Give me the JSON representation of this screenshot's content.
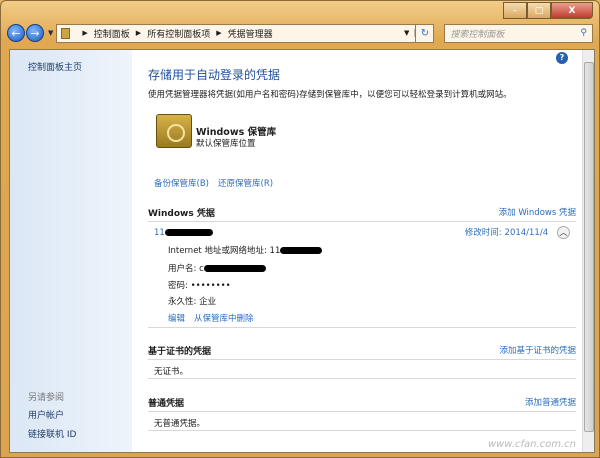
{
  "window": {
    "min": "–",
    "max": "□",
    "close": "X"
  },
  "nav": {
    "back": "←",
    "forward": "→",
    "breadcrumb": [
      "控制面板",
      "所有控制面板项",
      "凭据管理器"
    ],
    "refresh": "↻",
    "search_placeholder": "搜索控制面板",
    "search_icon": "search-icon"
  },
  "sidebar": {
    "home": "控制面板主页",
    "see_also": "另请参阅",
    "links": [
      "用户帐户",
      "链接联机 ID"
    ]
  },
  "main": {
    "title": "存储用于自动登录的凭据",
    "description": "使用凭据管理器将凭据(如用户名和密码)存储到保管库中，以便您可以轻松登录到计算机或网站。",
    "vault_name": "Windows 保管库",
    "vault_sub": "默认保管库位置",
    "backup": "备份保管库(B)",
    "restore": "还原保管库(R)",
    "windows_creds": {
      "header": "Windows 凭据",
      "add": "添加 Windows 凭据",
      "item": {
        "name_prefix": "11",
        "modified_label": "修改时间:",
        "modified": "2014/11/4",
        "address_label": "Internet 地址或网络地址:",
        "address_prefix": "11",
        "username_label": "用户名:",
        "username_prefix": "c",
        "password_label": "密码:",
        "password": "••••••••",
        "persistence_label": "永久性:",
        "persistence": "企业",
        "edit": "编辑",
        "delete": "从保管库中删除"
      }
    },
    "cert_creds": {
      "header": "基于证书的凭据",
      "add": "添加基于证书的凭据",
      "empty": "无证书。"
    },
    "generic_creds": {
      "header": "普通凭据",
      "add": "添加普通凭据",
      "empty": "无普通凭据。"
    }
  },
  "watermark": "www.cfan.com.cn"
}
